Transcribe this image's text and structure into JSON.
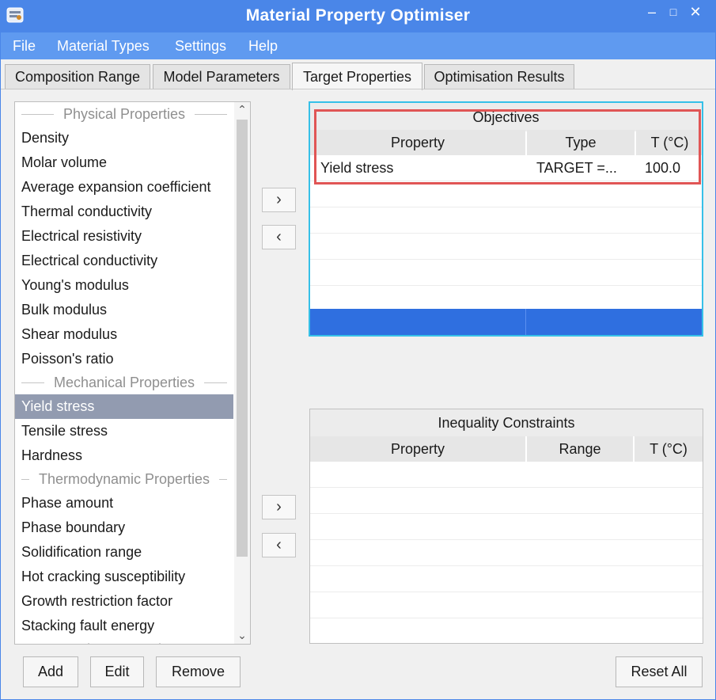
{
  "window": {
    "title": "Material Property Optimiser",
    "minimize_label": "–",
    "maximize_label": "□",
    "close_label": "✕"
  },
  "menu": [
    "File",
    "Material Types",
    "Settings",
    "Help"
  ],
  "tabs": [
    "Composition Range",
    "Model Parameters",
    "Target Properties",
    "Optimisation Results"
  ],
  "active_tab": "Target Properties",
  "property_list": {
    "groups": [
      {
        "header": "Physical Properties",
        "items": [
          "Density",
          "Molar volume",
          "Average expansion coefficient",
          "Thermal conductivity",
          "Electrical resistivity",
          "Electrical conductivity",
          "Young's modulus",
          "Bulk modulus",
          "Shear modulus",
          "Poisson's ratio"
        ]
      },
      {
        "header": "Mechanical Properties",
        "items": [
          "Yield stress",
          "Tensile stress",
          "Hardness"
        ]
      },
      {
        "header": "Thermodynamic Properties",
        "items": [
          "Phase amount",
          "Phase boundary",
          "Solidification range",
          "Hot cracking susceptibility",
          "Growth restriction factor",
          "Stacking fault energy"
        ]
      },
      {
        "header": "Other Properties",
        "items": []
      }
    ],
    "selected": "Yield stress"
  },
  "arrows": {
    "add": "›",
    "remove": "‹"
  },
  "objectives": {
    "title": "Objectives",
    "columns": [
      "Property",
      "Type",
      "T (°C)"
    ],
    "rows": [
      {
        "property": "Yield stress",
        "type": "TARGET =...",
        "temp": "100.0"
      }
    ]
  },
  "constraints": {
    "title": "Inequality Constraints",
    "columns": [
      "Property",
      "Range",
      "T (°C)"
    ],
    "rows": []
  },
  "buttons": {
    "add": "Add",
    "edit": "Edit",
    "remove": "Remove",
    "reset_all": "Reset All"
  },
  "colors": {
    "titlebar": "#4a86e8",
    "selection": "#929bb0",
    "table_selection": "#2f6fe0",
    "focus_border": "#36c0e8",
    "annotation": "#e05555"
  }
}
